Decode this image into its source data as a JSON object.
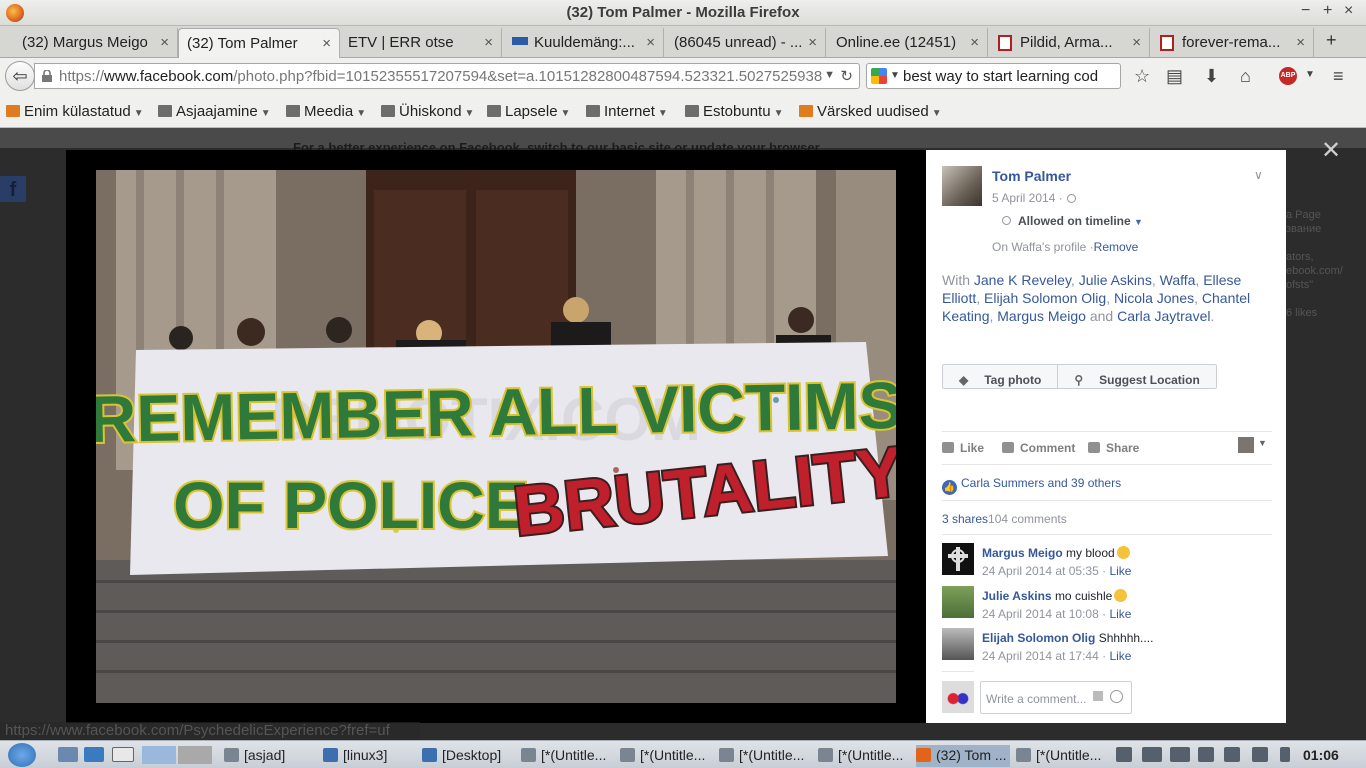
{
  "window": {
    "title": "(32) Tom Palmer - Mozilla Firefox",
    "controls": [
      "−",
      "+",
      "×"
    ]
  },
  "tabs": [
    {
      "label": "(32) Margus Meigo",
      "active": false
    },
    {
      "label": "(32) Tom Palmer",
      "active": true
    },
    {
      "label": "ETV | ERR otse",
      "active": false
    },
    {
      "label": "Kuuldemäng:...",
      "active": false
    },
    {
      "label": "(86045 unread) - ...",
      "active": false
    },
    {
      "label": "Online.ee (12451)",
      "active": false
    },
    {
      "label": "Pildid, Arma...",
      "active": false
    },
    {
      "label": "forever-rema...",
      "active": false
    }
  ],
  "new_tab": "+",
  "url": {
    "scheme": "https://",
    "host": "www.facebook.com",
    "path": "/photo.php?fbid=10152355517207594&set=a.10151282800487594.523321.5027525938"
  },
  "search": {
    "value": "best way to start learning cod"
  },
  "bookmarks": [
    {
      "label": "Enim külastatud"
    },
    {
      "label": "Asjaajamine"
    },
    {
      "label": "Meedia"
    },
    {
      "label": "Ühiskond"
    },
    {
      "label": "Lapsele"
    },
    {
      "label": "Internet"
    },
    {
      "label": "Estobuntu"
    },
    {
      "label": "Värsked uudised"
    }
  ],
  "page": {
    "notice": "For a better experience on Facebook, switch to our basic site or update your browser.",
    "behind_text": [
      "a Page",
      "звание",
      "",
      "ators,",
      "ebook.com/",
      "ofsts\"",
      "",
      "6 likes"
    ]
  },
  "photo": {
    "banner_line1": "REMEMBER ALL VICTIMS",
    "banner_line2a": "OF POLICE",
    "banner_line2b": "BRUTALITY",
    "watermark": "DEMOTIX.COM"
  },
  "post": {
    "author": "Tom Palmer",
    "date": "5 April 2014 ·",
    "timeline": "Allowed on timeline",
    "profile_note": "On Waffa's profile ·",
    "remove": "Remove",
    "with_prefix": "With",
    "tagged": [
      "Jane K Reveley",
      "Julie Askins",
      "Waffa",
      "Ellese Elliott",
      "Elijah Solomon Olig",
      "Nicola Jones",
      "Chantel Keating",
      "Margus Meigo"
    ],
    "and_word": "and",
    "last_tagged": "Carla Jaytravel",
    "tag_photo": "Tag photo",
    "suggest_location": "Suggest Location",
    "like": "Like",
    "comment": "Comment",
    "share": "Share",
    "likes_summary": "Carla Summers and 39 others",
    "shares": "3 shares",
    "comments_count": "104 comments",
    "write_placeholder": "Write a comment..."
  },
  "comments": [
    {
      "name": "Margus Meigo",
      "text": "my blood",
      "time": "24 April 2014 at 05:35 ·",
      "like": "Like"
    },
    {
      "name": "Julie Askins",
      "text": "mo cuishle",
      "time": "24 April 2014 at 10:08 ·",
      "like": "Like"
    },
    {
      "name": "Elijah Solomon Olig",
      "text": "Shhhhh....",
      "time": "24 April 2014 at 17:44 ·",
      "like": "Like"
    }
  ],
  "statusbar": "https://www.facebook.com/PsychedelicExperience?fref=uf",
  "taskbar": {
    "items": [
      "[asjad]",
      "[linux3]",
      "[Desktop]",
      "[*(Untitle...",
      "[*(Untitle...",
      "[*(Untitle...",
      "[*(Untitle...",
      "(32) Tom ...",
      "[*(Untitle..."
    ],
    "clock": "01:06"
  },
  "colors": {
    "fb_blue": "#365899",
    "grey_text": "#90949c"
  }
}
